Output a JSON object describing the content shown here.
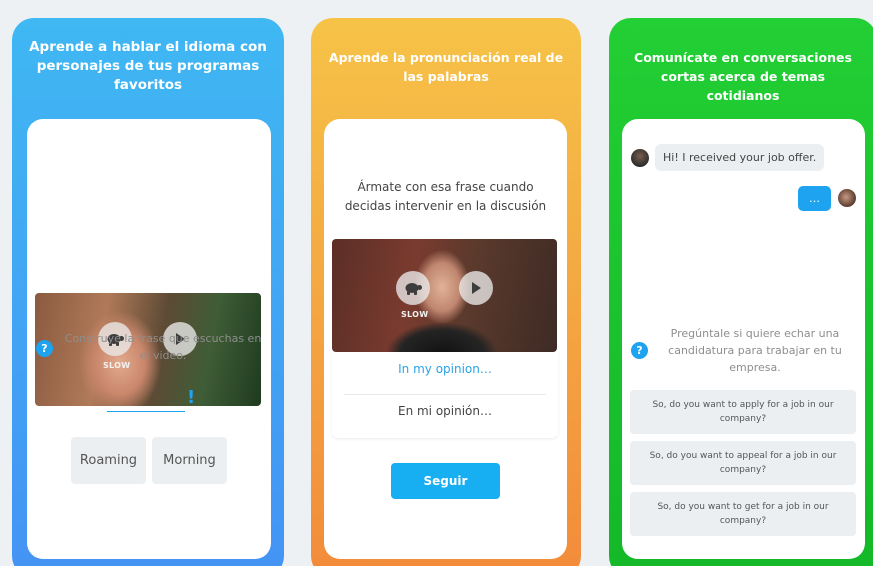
{
  "cards": [
    {
      "title": "Aprende a hablar el idioma con personajes de tus programas favoritos",
      "slow_label": "SLOW",
      "instruction": "Construye la frase que escuchas en el video.",
      "blank_punct": "!",
      "words": [
        "Roaming",
        "Morning"
      ]
    },
    {
      "title": "Aprende la pronunciación real de las palabras",
      "prompt": "Ármate con esa frase cuando decidas intervenir en la discusión",
      "slow_label": "SLOW",
      "choice_en": "In my opinion…",
      "choice_es": "En mi opinión…",
      "button": "Seguir"
    },
    {
      "title": "Comunícate en conversaciones cortas acerca de temas cotidianos",
      "incoming": "Hi! I received your job offer.",
      "outgoing": "…",
      "instruction": "Pregúntale si quiere echar una candidatura para trabajar en tu empresa.",
      "options": [
        "So, do you want to apply for a job in our company?",
        "So, do you want to appeal for a job in our company?",
        "So, do you want to get for a job in our company?"
      ]
    }
  ],
  "colors": {
    "blue_card": "#3fb8f3",
    "orange_card": "#f6c347",
    "green_card": "#22cf34",
    "accent": "#1ea3f0"
  },
  "icons": [
    "turtle-icon",
    "play-icon",
    "help-icon",
    "avatar-icon"
  ]
}
